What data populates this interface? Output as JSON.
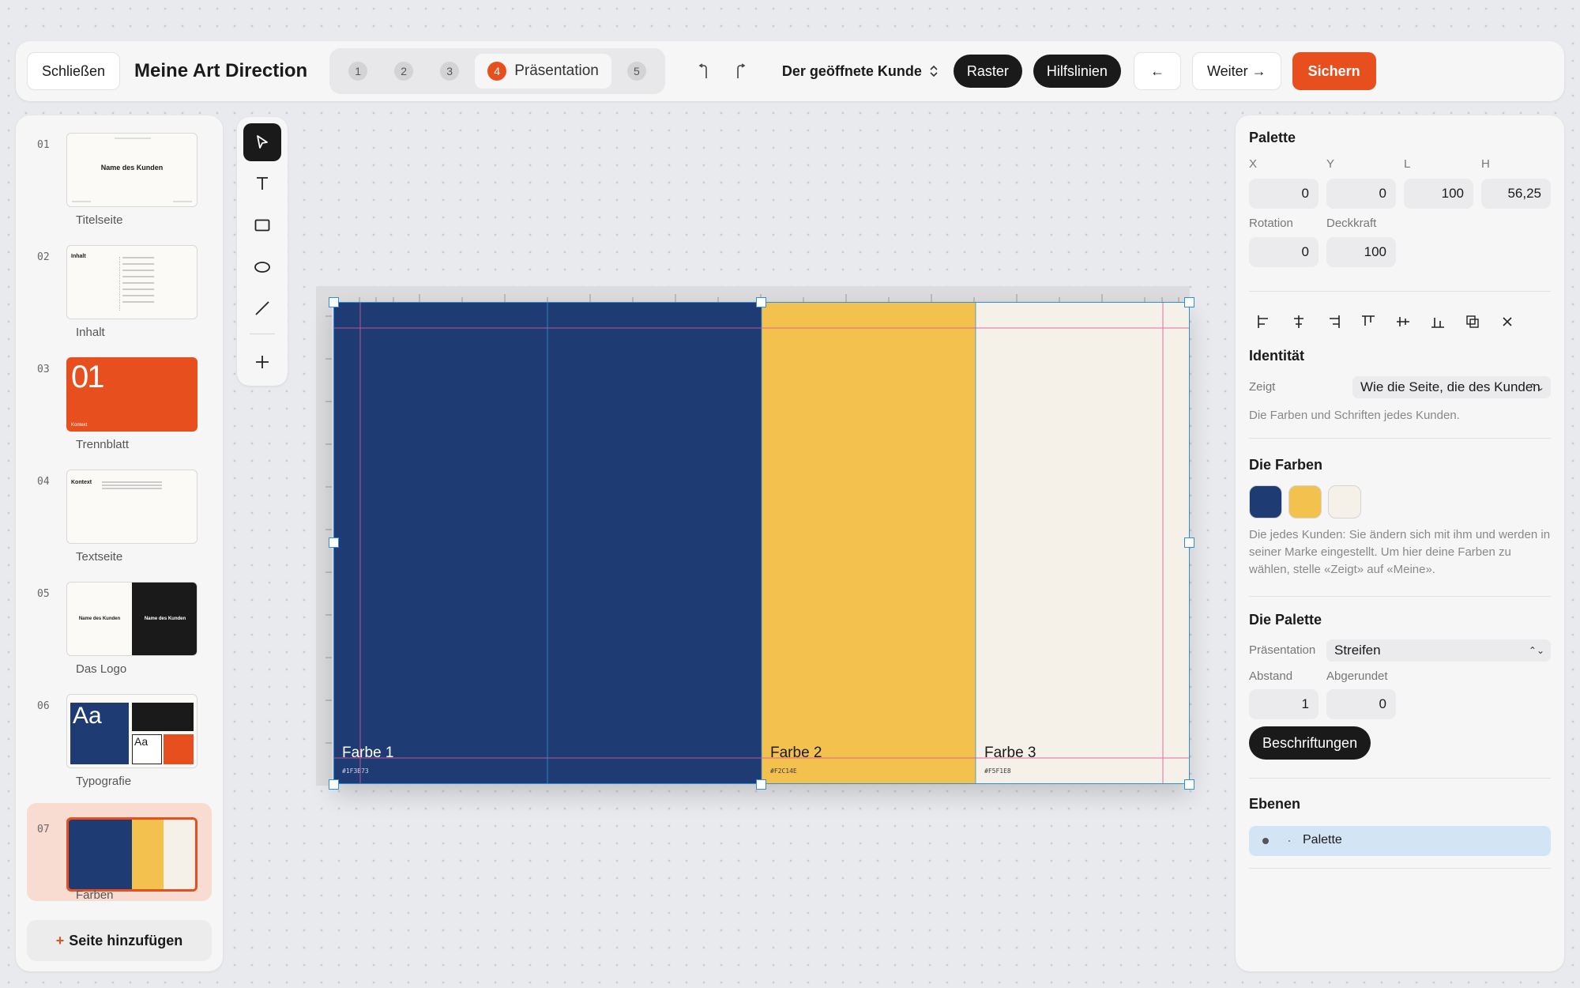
{
  "topbar": {
    "close_label": "Schließen",
    "title": "Meine Art Direction",
    "steps": [
      {
        "num": "1"
      },
      {
        "num": "2"
      },
      {
        "num": "3"
      },
      {
        "num": "4",
        "label": "Präsentation"
      },
      {
        "num": "5"
      }
    ],
    "undo_icon": "undo-icon",
    "redo_icon": "redo-icon",
    "client": "Der geöffnete Kunde",
    "raster_label": "Raster",
    "guides_label": "Hilfslinien",
    "back_label": "←",
    "next_label": "Weiter →",
    "save_label": "Sichern",
    "accent_color": "#e84f1f"
  },
  "pages": [
    {
      "num": "01",
      "label": "Titelseite",
      "thumb_text": "Name des Kunden"
    },
    {
      "num": "02",
      "label": "Inhalt",
      "thumb_text": "Inhalt"
    },
    {
      "num": "03",
      "label": "Trennblatt",
      "thumb_text": "01",
      "thumb_sub": "Kontext"
    },
    {
      "num": "04",
      "label": "Textseite",
      "thumb_text": "Kontext"
    },
    {
      "num": "05",
      "label": "Das Logo",
      "thumb_text": "Name des Kunden",
      "thumb_text2": "Name des Kunden"
    },
    {
      "num": "06",
      "label": "Typografie",
      "thumb_text": "Aa",
      "thumb_text2": "Aa"
    },
    {
      "num": "07",
      "label": "Farben",
      "active": true
    }
  ],
  "add_page_label": "Seite hinzufügen",
  "tools": [
    "pointer-icon",
    "text-icon",
    "rectangle-icon",
    "ellipse-icon",
    "line-icon",
    "plus-icon"
  ],
  "canvas": {
    "stripes": [
      {
        "name": "Farbe 1",
        "hex": "#1F3B73",
        "color": "#1f3b73"
      },
      {
        "name": "Farbe 2",
        "hex": "#F2C14E",
        "color": "#f2c14e"
      },
      {
        "name": "Farbe 3",
        "hex": "#F5F1E8",
        "color": "#f5f1e8"
      }
    ]
  },
  "props": {
    "title": "Palette",
    "x_label": "X",
    "x": "0",
    "y_label": "Y",
    "y": "0",
    "l_label": "L",
    "l": "100",
    "h_label": "H",
    "h": "56,25",
    "rotation_label": "Rotation",
    "rotation": "0",
    "opacity_label": "Deckkraft",
    "opacity": "100",
    "identity_title": "Identität",
    "shows_label": "Zeigt",
    "shows_value": "Wie die Seite, die des Kunden",
    "identity_desc": "Die Farben und Schriften jedes Kunden.",
    "colors_title": "Die Farben",
    "colors_desc": "Die jedes Kunden: Sie ändern sich mit ihm und werden in seiner Marke eingestellt. Um hier deine Farben zu wählen, stelle «Zeigt» auf «Meine».",
    "palette_title": "Die Palette",
    "presentation_label": "Präsentation",
    "presentation_value": "Streifen",
    "spacing_label": "Abstand",
    "spacing": "1",
    "rounded_label": "Abgerundet",
    "rounded": "0",
    "captions_label": "Beschriftungen",
    "layers_title": "Ebenen",
    "layer_name": "Palette"
  }
}
